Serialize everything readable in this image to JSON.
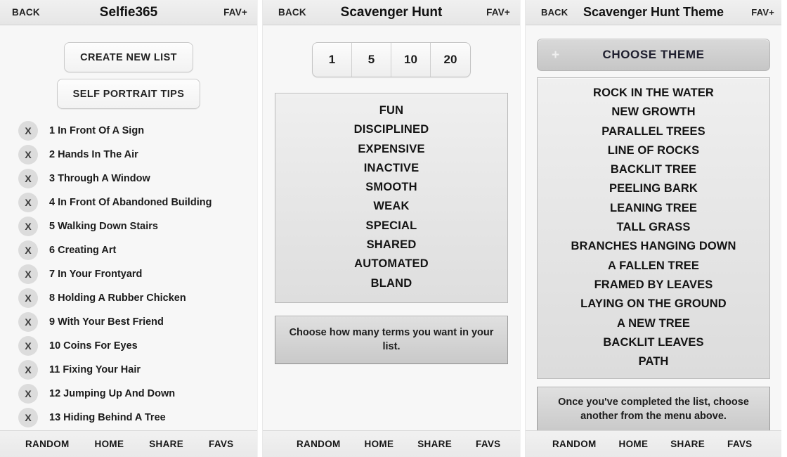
{
  "panel1": {
    "header": {
      "back": "BACK",
      "title": "Selfie365",
      "fav": "FAV+"
    },
    "buttons": [
      {
        "label": "CREATE NEW LIST"
      },
      {
        "label": "SELF PORTRAIT TIPS"
      }
    ],
    "delete_glyph": "X",
    "items": [
      "1 In Front Of A Sign",
      "2 Hands In The Air",
      "3 Through A Window",
      "4 In Front Of Abandoned Building",
      "5 Walking Down Stairs",
      "6 Creating Art",
      "7 In Your Frontyard",
      "8 Holding A Rubber Chicken",
      "9 With Your Best Friend",
      "10 Coins For Eyes",
      "11 Fixing Your Hair",
      "12 Jumping Up And Down",
      "13 Hiding Behind A Tree"
    ],
    "tabs": [
      "RANDOM",
      "HOME",
      "SHARE",
      "FAVS"
    ]
  },
  "panel2": {
    "header": {
      "back": "BACK",
      "title": "Scavenger Hunt",
      "fav": "FAV+"
    },
    "segments": [
      "1",
      "5",
      "10",
      "20"
    ],
    "words": [
      "FUN",
      "DISCIPLINED",
      "EXPENSIVE",
      "INACTIVE",
      "SMOOTH",
      "WEAK",
      "SPECIAL",
      "SHARED",
      "AUTOMATED",
      "BLAND"
    ],
    "info": "Choose how many terms you want in your list.",
    "tabs": [
      "RANDOM",
      "HOME",
      "SHARE",
      "FAVS"
    ]
  },
  "panel3": {
    "header": {
      "back": "BACK",
      "title": "Scavenger Hunt Theme",
      "fav": "FAV+"
    },
    "choose_theme": {
      "plus": "+",
      "label": "CHOOSE THEME"
    },
    "themes": [
      "ROCK IN THE WATER",
      "NEW GROWTH",
      "PARALLEL TREES",
      "LINE OF ROCKS",
      "BACKLIT TREE",
      "PEELING BARK",
      "LEANING TREE",
      "TALL GRASS",
      "BRANCHES HANGING DOWN",
      "A FALLEN TREE",
      "FRAMED BY LEAVES",
      "LAYING ON THE GROUND",
      "A NEW TREE",
      "BACKLIT LEAVES",
      "PATH"
    ],
    "info": "Once you've completed the list, choose another from the menu above.",
    "tabs": [
      "RANDOM",
      "HOME",
      "SHARE",
      "FAVS"
    ]
  }
}
